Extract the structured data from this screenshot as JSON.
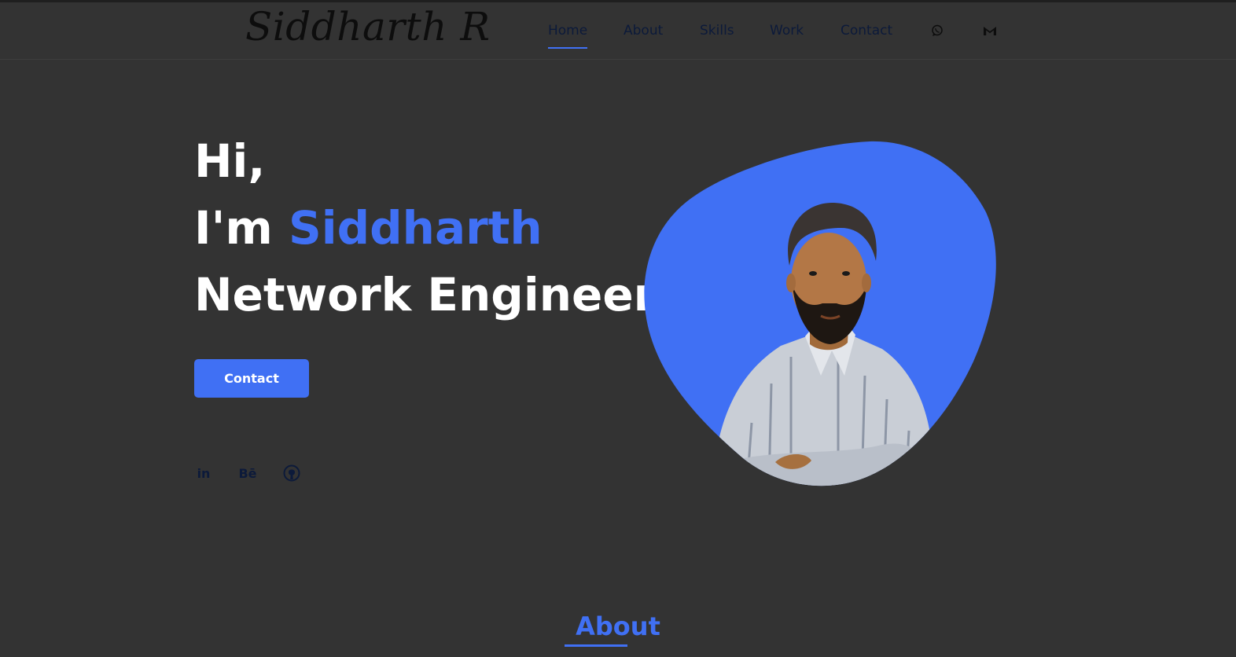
{
  "brand": {
    "logo_text": "Siddharth R"
  },
  "nav": {
    "items": [
      {
        "label": "Home",
        "active": true
      },
      {
        "label": "About"
      },
      {
        "label": "Skills"
      },
      {
        "label": "Work"
      },
      {
        "label": "Contact"
      }
    ],
    "icons": [
      "whatsapp-icon",
      "gmail-icon"
    ]
  },
  "hero": {
    "greeting": "Hi,",
    "intro_prefix": "I'm ",
    "name": "Siddharth",
    "role": "Network Engineer",
    "contact_button": "Contact",
    "socials": [
      {
        "icon": "linkedin-icon",
        "text": "in"
      },
      {
        "icon": "behance-icon",
        "text": "Bē"
      },
      {
        "icon": "github-icon"
      }
    ],
    "photo": "profile-photo"
  },
  "about": {
    "title": "About"
  },
  "colors": {
    "accent": "#4070f4",
    "background": "#333333",
    "nav_text": "#0c1a3a",
    "white": "#ffffff"
  }
}
